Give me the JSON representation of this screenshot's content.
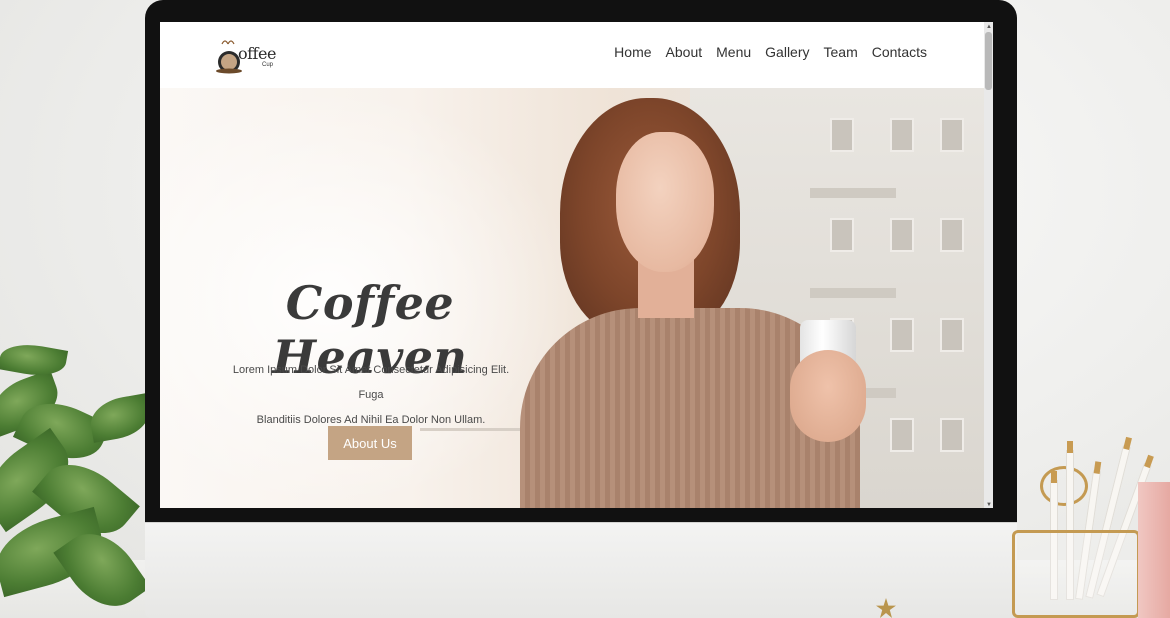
{
  "site": {
    "logo_text": "offee",
    "logo_sub": "Cup"
  },
  "nav": {
    "items": [
      {
        "label": "Home"
      },
      {
        "label": "About"
      },
      {
        "label": "Menu"
      },
      {
        "label": "Gallery"
      },
      {
        "label": "Team"
      },
      {
        "label": "Contacts"
      }
    ]
  },
  "hero": {
    "title": "Coffee Heaven",
    "copy_line_1": "Lorem Ipsum Dolor Sit Amet Consectetur Adipisicing Elit. Fuga",
    "copy_line_2": "Blanditiis Dolores Ad Nihil Ea Dolor Non Ullam.",
    "button_label": "About Us"
  },
  "colors": {
    "accent": "#c4a484",
    "text": "#3a3a3a"
  },
  "icons": {
    "logo": "coffee-cup-icon",
    "scroll_up": "triangle-up-icon",
    "scroll_down": "triangle-down-icon"
  }
}
